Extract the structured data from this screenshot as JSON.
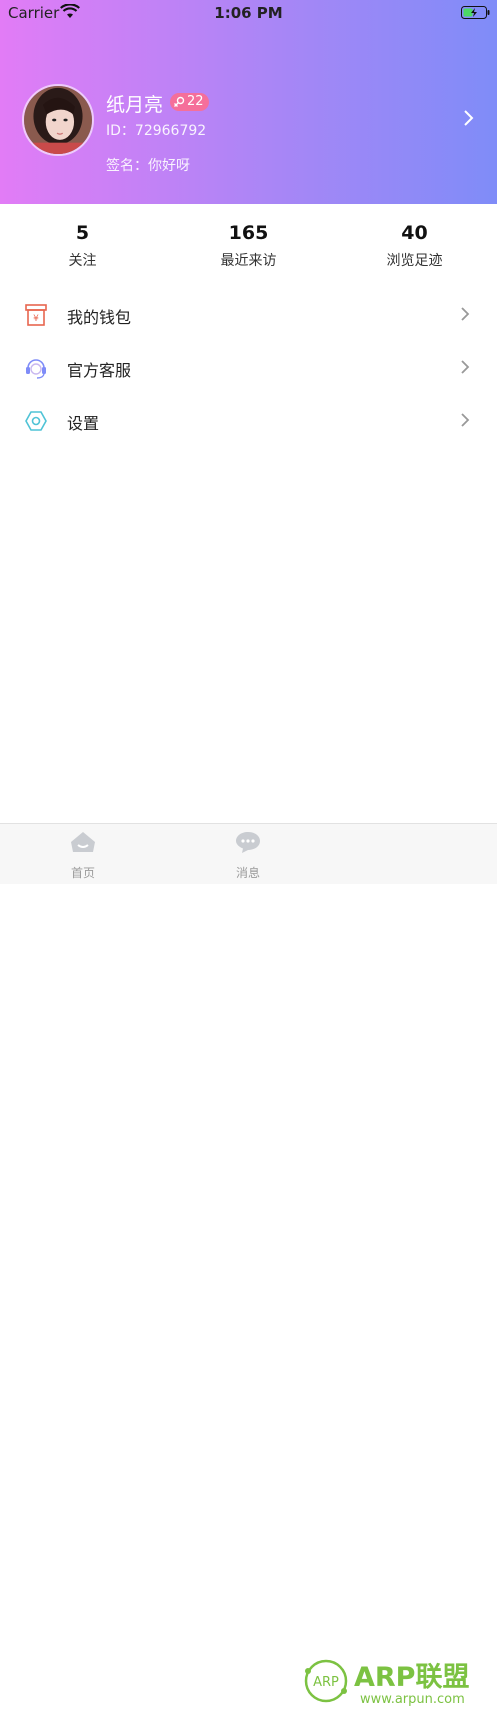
{
  "status_bar": {
    "carrier": "Carrier",
    "time": "1:06 PM"
  },
  "profile": {
    "name": "纸月亮",
    "badge_value": "22",
    "id_text": "ID：72966792",
    "signature": "签名：你好呀"
  },
  "stats": [
    {
      "value": "5",
      "label": "关注"
    },
    {
      "value": "165",
      "label": "最近来访"
    },
    {
      "value": "40",
      "label": "浏览足迹"
    }
  ],
  "menu": [
    {
      "label": "我的钱包",
      "icon": "wallet-icon"
    },
    {
      "label": "官方客服",
      "icon": "customer-service-icon"
    },
    {
      "label": "设置",
      "icon": "settings-icon"
    }
  ],
  "tabbar": [
    {
      "label": "首页",
      "icon": "home-icon"
    },
    {
      "label": "消息",
      "icon": "message-icon"
    }
  ],
  "watermark": {
    "logo_text": "ARP",
    "brand": "ARP联盟",
    "url": "www.arpun.com"
  },
  "colors": {
    "gradient_start": "#e27cf6",
    "gradient_end": "#7f8cf8",
    "badge": "#f56f9a",
    "wallet_icon": "#e8664f",
    "service_icon": "#7f8cf8",
    "settings_icon": "#4fc3d6",
    "watermark_green": "#7cc242"
  }
}
